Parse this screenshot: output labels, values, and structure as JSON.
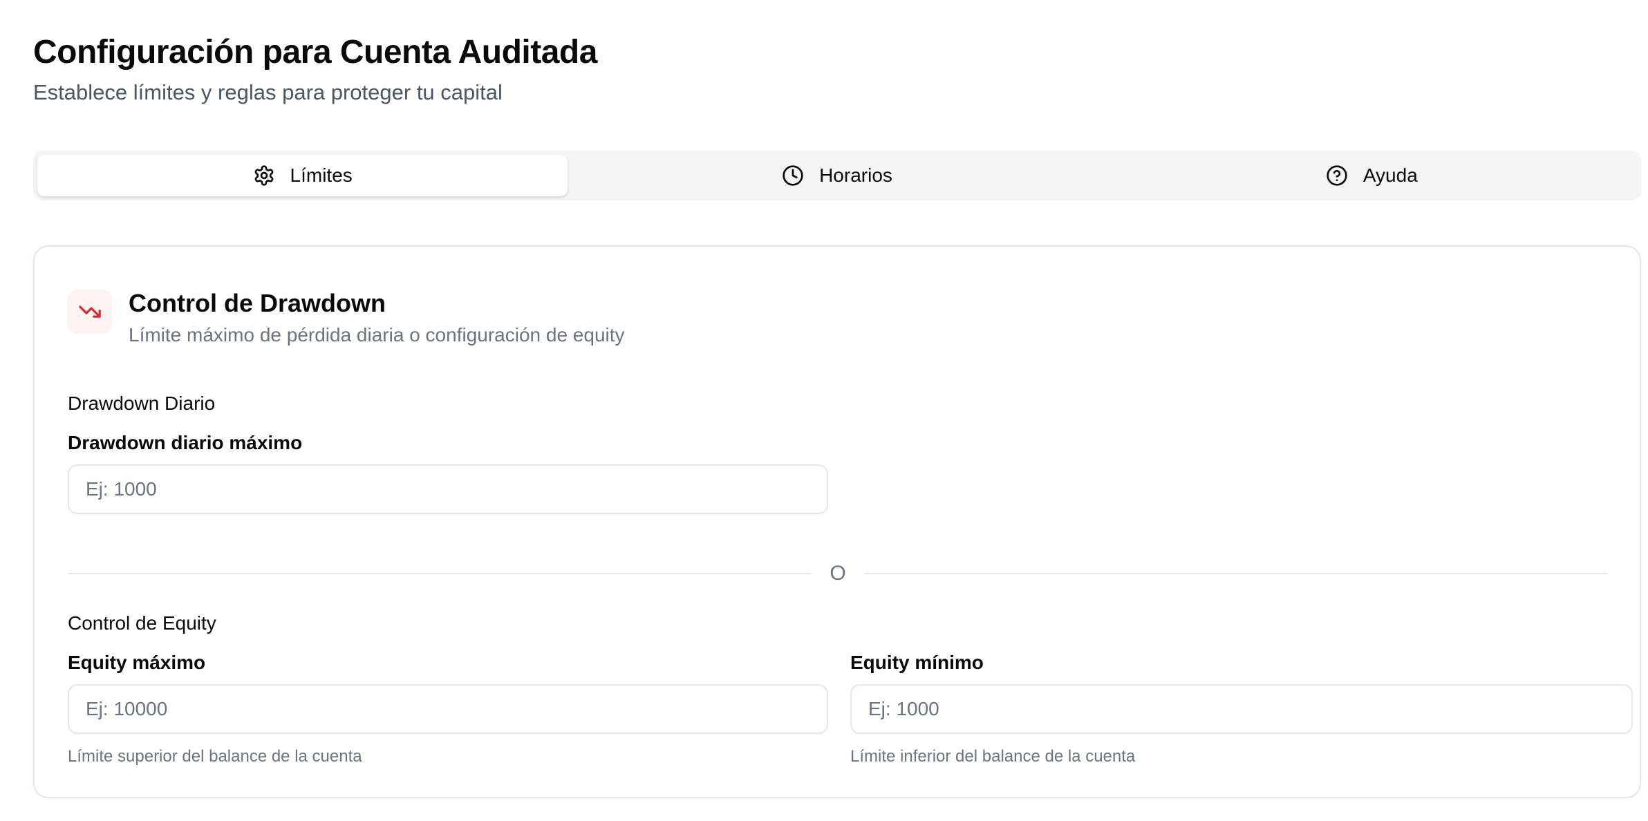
{
  "header": {
    "title": "Configuración para Cuenta Auditada",
    "subtitle": "Establece límites y reglas para proteger tu capital"
  },
  "tabs": [
    {
      "label": "Límites",
      "icon": "gear-icon",
      "active": true
    },
    {
      "label": "Horarios",
      "icon": "clock-icon",
      "active": false
    },
    {
      "label": "Ayuda",
      "icon": "help-circle-icon",
      "active": false
    }
  ],
  "card": {
    "icon": "trending-down-icon",
    "title": "Control de Drawdown",
    "description": "Límite máximo de pérdida diaria o configuración de equity",
    "drawdown": {
      "section_label": "Drawdown Diario",
      "field_label": "Drawdown diario máximo",
      "placeholder": "Ej: 1000",
      "value": ""
    },
    "divider_text": "O",
    "equity": {
      "section_label": "Control de Equity",
      "max": {
        "label": "Equity máximo",
        "placeholder": "Ej: 10000",
        "value": "",
        "helper": "Límite superior del balance de la cuenta"
      },
      "min": {
        "label": "Equity mínimo",
        "placeholder": "Ej: 1000",
        "value": "",
        "helper": "Límite inferior del balance de la cuenta"
      }
    }
  },
  "colors": {
    "accent_red": "#dc2626",
    "icon_bg": "#fef2f2",
    "muted_text": "#6b7280",
    "border": "#e5e7eb",
    "tabs_bg": "#f4f4f5"
  }
}
